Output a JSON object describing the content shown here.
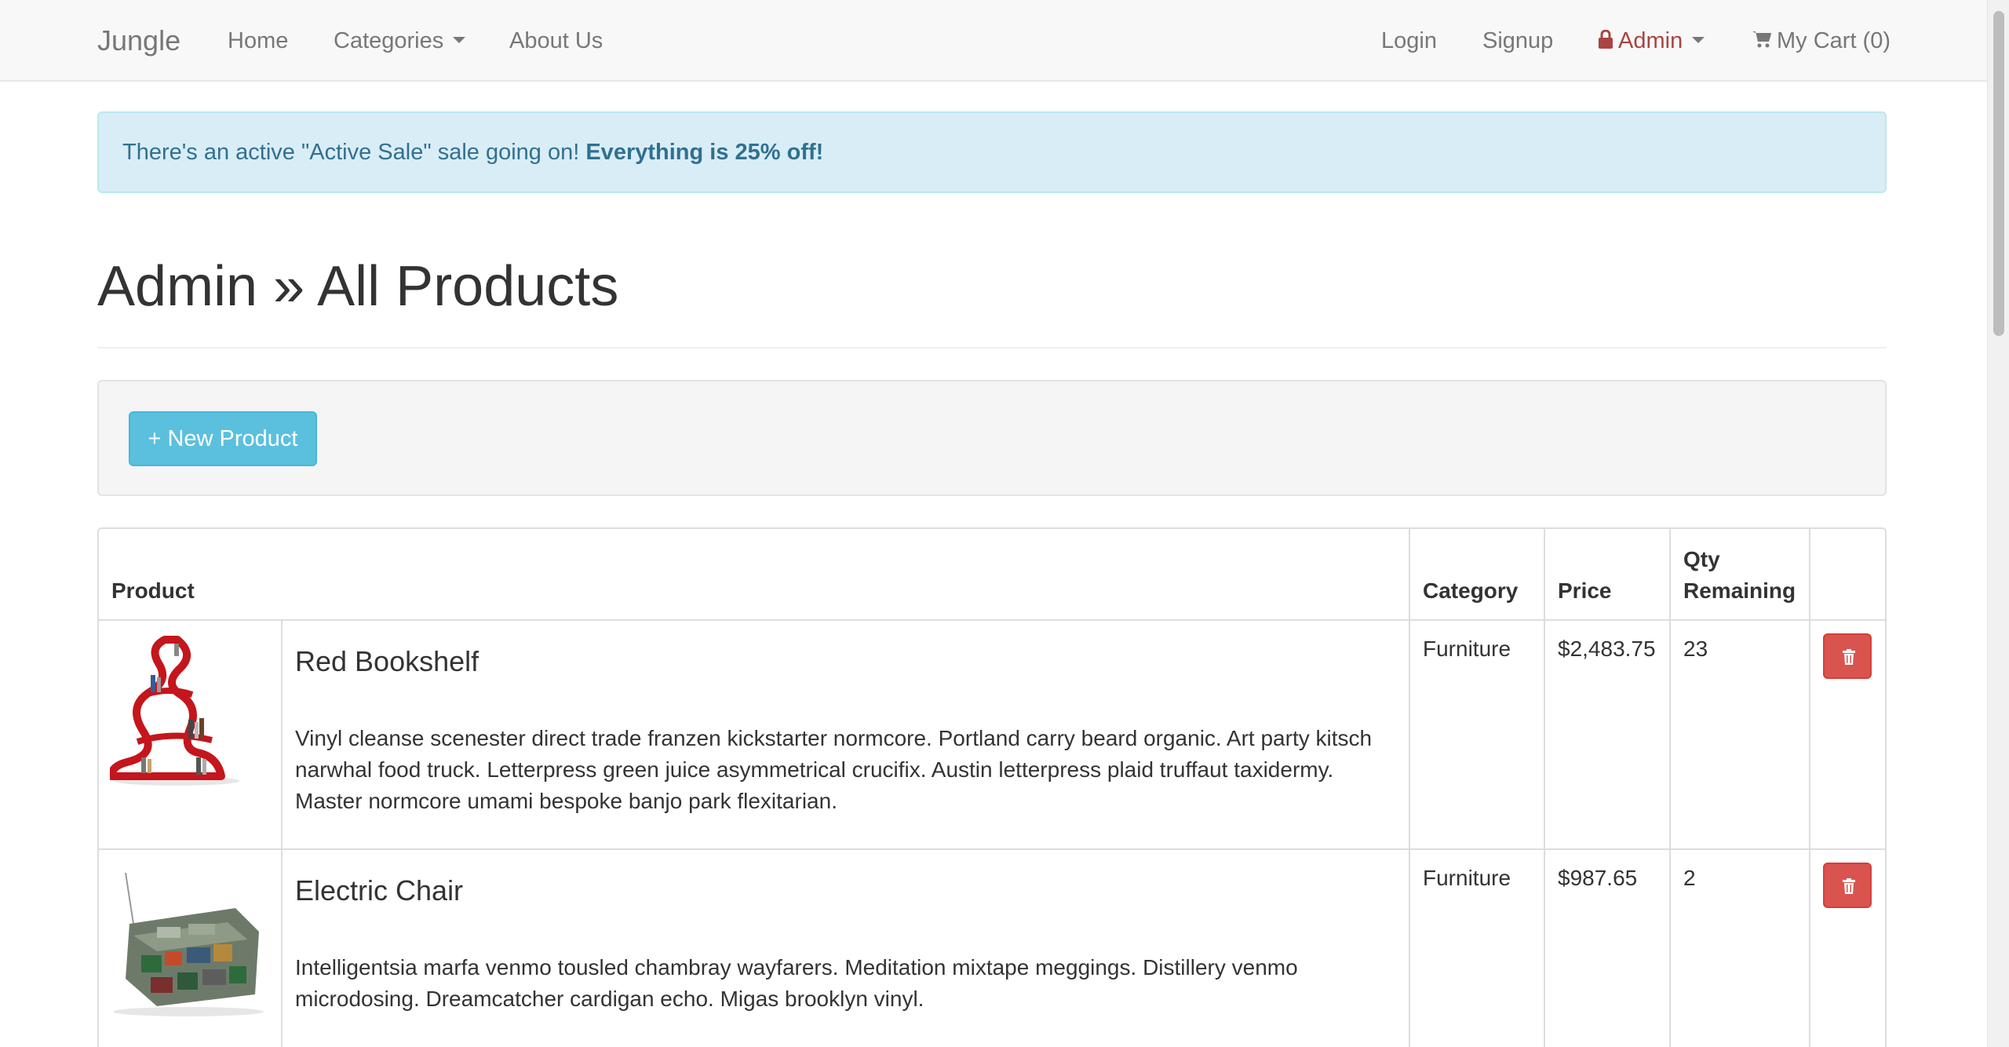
{
  "nav": {
    "brand": "Jungle",
    "home": "Home",
    "categories": "Categories",
    "about": "About Us",
    "login": "Login",
    "signup": "Signup",
    "admin": "Admin",
    "cart": "My Cart (0)",
    "icons": {
      "admin": "lock-icon",
      "cart": "shopping-cart-icon",
      "dropdown": "caret-down-icon"
    },
    "colors": {
      "admin": "#a94442",
      "link": "#777777"
    }
  },
  "alert": {
    "text": "There's an active \"Active Sale\" sale going on!",
    "emphasis": "Everything is 25% off!"
  },
  "page": {
    "title": "Admin » All Products"
  },
  "actions": {
    "new_product": "+ New Product"
  },
  "table": {
    "headers": {
      "product": "Product",
      "category": "Category",
      "price": "Price",
      "qty": "Qty Remaining"
    },
    "rows": [
      {
        "image": "red-bookshelf-image",
        "name": "Red Bookshelf",
        "description": "Vinyl cleanse scenester direct trade franzen kickstarter normcore. Portland carry beard organic. Art party kitsch narwhal food truck. Letterpress green juice asymmetrical crucifix. Austin letterpress plaid truffaut taxidermy. Master normcore umami bespoke banjo park flexitarian.",
        "category": "Furniture",
        "price": "$2,483.75",
        "qty": "23"
      },
      {
        "image": "electric-chair-image",
        "name": "Electric Chair",
        "description": "Intelligentsia marfa venmo tousled chambray wayfarers. Meditation mixtape meggings. Distillery venmo microdosing. Dreamcatcher cardigan echo. Migas brooklyn vinyl.",
        "category": "Furniture",
        "price": "$987.65",
        "qty": "2"
      }
    ],
    "delete_icon": "trash-icon"
  },
  "colors": {
    "alert_bg": "#d9edf7",
    "alert_text": "#31708f",
    "info_button": "#5bc0de",
    "danger_button": "#d9534f"
  }
}
